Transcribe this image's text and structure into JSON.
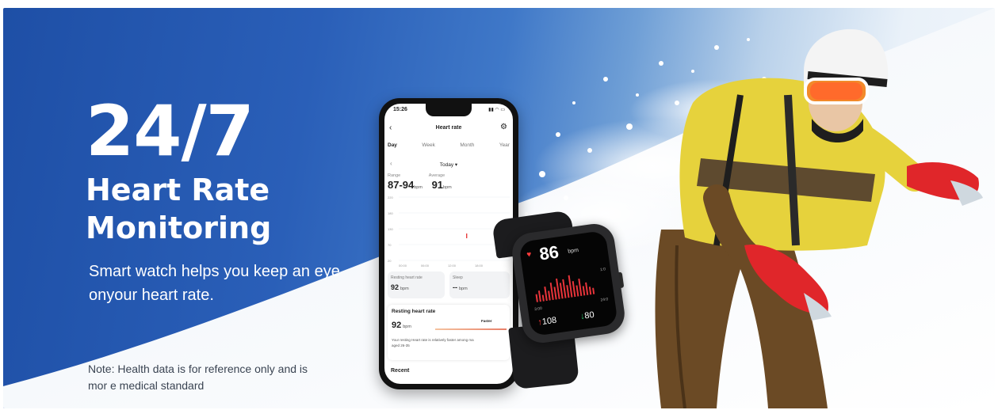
{
  "headline": {
    "big": "24/7",
    "line1": "Heart Rate",
    "line2": "Monitoring"
  },
  "subtitle": {
    "line1": "Smart watch helps you keep an eye",
    "line2": "onyour heart rate."
  },
  "note": {
    "line1": "Note: Health data is for reference only and is",
    "line2": "mor e medical standard"
  },
  "phone": {
    "status_time": "15:26",
    "title": "Heart rate",
    "tabs": [
      "Day",
      "Week",
      "Month",
      "Year"
    ],
    "date_label": "Today ▾",
    "range_label": "Range",
    "range_value": "87-94",
    "range_unit": "bpm",
    "average_label": "Average",
    "average_value": "91",
    "average_unit": "bpm",
    "y_ticks": [
      "220",
      "180",
      "130",
      "70",
      "20"
    ],
    "x_ticks": [
      "00:00",
      "06:00",
      "12:00",
      "18:00"
    ],
    "card_resting_label": "Resting heart rate",
    "card_resting_value": "92",
    "card_resting_unit": "bpm",
    "card_sleep_label": "Sleep",
    "card_sleep_value": "--",
    "card_sleep_unit": "bpm",
    "rhr_title": "Resting heart rate",
    "rhr_value": "92",
    "rhr_unit": "bpm",
    "rhr_faster": "Faster",
    "rhr_desc_1": "Your resting Heart rate is relatively faster among ma",
    "rhr_desc_2": "aged 26-35",
    "recent_label": "Recent"
  },
  "watch": {
    "bpm": "86",
    "bpm_unit": "bpm",
    "max": "108",
    "min": "80",
    "scale_top": "1:0",
    "time_left": "3:00",
    "time_right": "24:0"
  },
  "colors": {
    "banner_blue": "#1e4fa6",
    "heart_red": "#ff3b3b",
    "glove_red": "#e0262a",
    "jacket_yellow": "#e6d23c"
  }
}
